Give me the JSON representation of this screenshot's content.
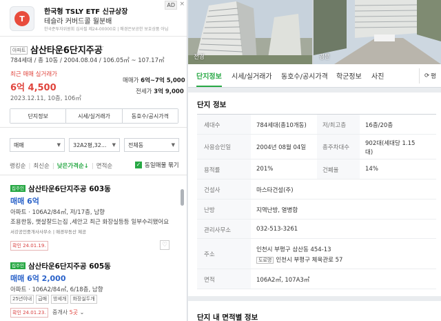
{
  "ad": {
    "logo_letter": "T",
    "title": "한국형 TSLY ETF 신규상장",
    "subtitle": "테슬라 커버드콜 월분배",
    "fine_print": "한국준투자위원회 심사필 제24-00000호 | 매경은보공한 보호상품 아님",
    "badge": "AD",
    "close": "×"
  },
  "summary": {
    "type_tag": "아파트",
    "title": "삼산타운6단지주공",
    "star": "☆",
    "meta": "784세대 / 총 10동 / 2004.08.04 / 106.05㎡ ~ 107.17㎡",
    "recent_label": "최근 매매 실거래가",
    "recent_price": "6억 4,500",
    "recent_date": "2023.12.11, 10층, 106㎡",
    "maemae_label": "매매가",
    "maemae_value": "6억~7억 5,000",
    "jeonse_label": "전세가",
    "jeonse_value": "3억 9,000",
    "buttons": [
      "단지정보",
      "시세/실거래가",
      "동호수/공시가격"
    ]
  },
  "filters": {
    "trade_type": "매매",
    "size": "32A2평,32...",
    "dong": "전체동",
    "sort": [
      "랭킹순",
      "최신순",
      "낮은가격순↓",
      "면적순"
    ],
    "sort_active": 2,
    "same_listing_label": "동일매물 묶기",
    "same_listing_checked": true
  },
  "listings": [
    {
      "badge": "집주인",
      "title": "삼산타운6단지주공 603동",
      "price": "매매 6억",
      "spec": "아파트 · 106A2/84㎡, 저/17층, 남향",
      "desc": "조용한동, 햇살잘드는집 ,세안고 최근 화장실등등 일부수리됐어요",
      "agent": "서강공인중개사사무소 | 매경부동산 제공",
      "confirm": "확인 24.01.19.",
      "fav": "♡"
    },
    {
      "badge": "집주인",
      "title": "삼산타운6단지주공 605동",
      "price": "매매 6억 2,000",
      "spec": "아파트 · 106A2/84㎡, 6/18층, 남향",
      "chips": [
        "25년이내",
        "급매",
        "방세개",
        "화장실두개"
      ],
      "confirm": "확인 24.01.23.",
      "agent_prefix": "중개사 ",
      "agent_count": "5곳",
      "agent_caret": "⌄"
    }
  ],
  "photos": [
    {
      "label": "전경"
    },
    {
      "label": "경문"
    }
  ],
  "tabs": [
    "단지정보",
    "시세/실거래가",
    "동호수/공시가격",
    "학군정보",
    "사진"
  ],
  "refresh_label": "평",
  "info": {
    "title": "단지 정보",
    "rows": [
      {
        "l1": "세대수",
        "v1": "784세대(총10개동)",
        "l2": "저/최고층",
        "v2": "16층/20층"
      },
      {
        "l1": "사용승인일",
        "v1": "2004년 08월 04일",
        "l2": "총주차대수",
        "v2a": "902대(세대당 1.15",
        "v2b": "대)"
      },
      {
        "l1": "용적률",
        "v1": "201%",
        "l2": "건폐율",
        "v2": "14%"
      },
      {
        "l1": "건설사",
        "v1": "마스타건설(주)"
      },
      {
        "l1": "난방",
        "v1": "지역난방, 열병합"
      },
      {
        "l1": "관리사무소",
        "v1": "032-513-3261"
      },
      {
        "l1": "주소",
        "v1": "인천시 부평구 삼산동 454-13",
        "road_tag": "도로명",
        "v1b": "인천시 부평구 체육관로 57"
      },
      {
        "l1": "면적",
        "v1": "106A2㎡, 107A3㎡"
      }
    ]
  },
  "area_title": "단지 내 면적별 정보",
  "colors": {
    "accent": "#27a844",
    "price_red": "#e0453d",
    "price_blue": "#2a62c9"
  }
}
